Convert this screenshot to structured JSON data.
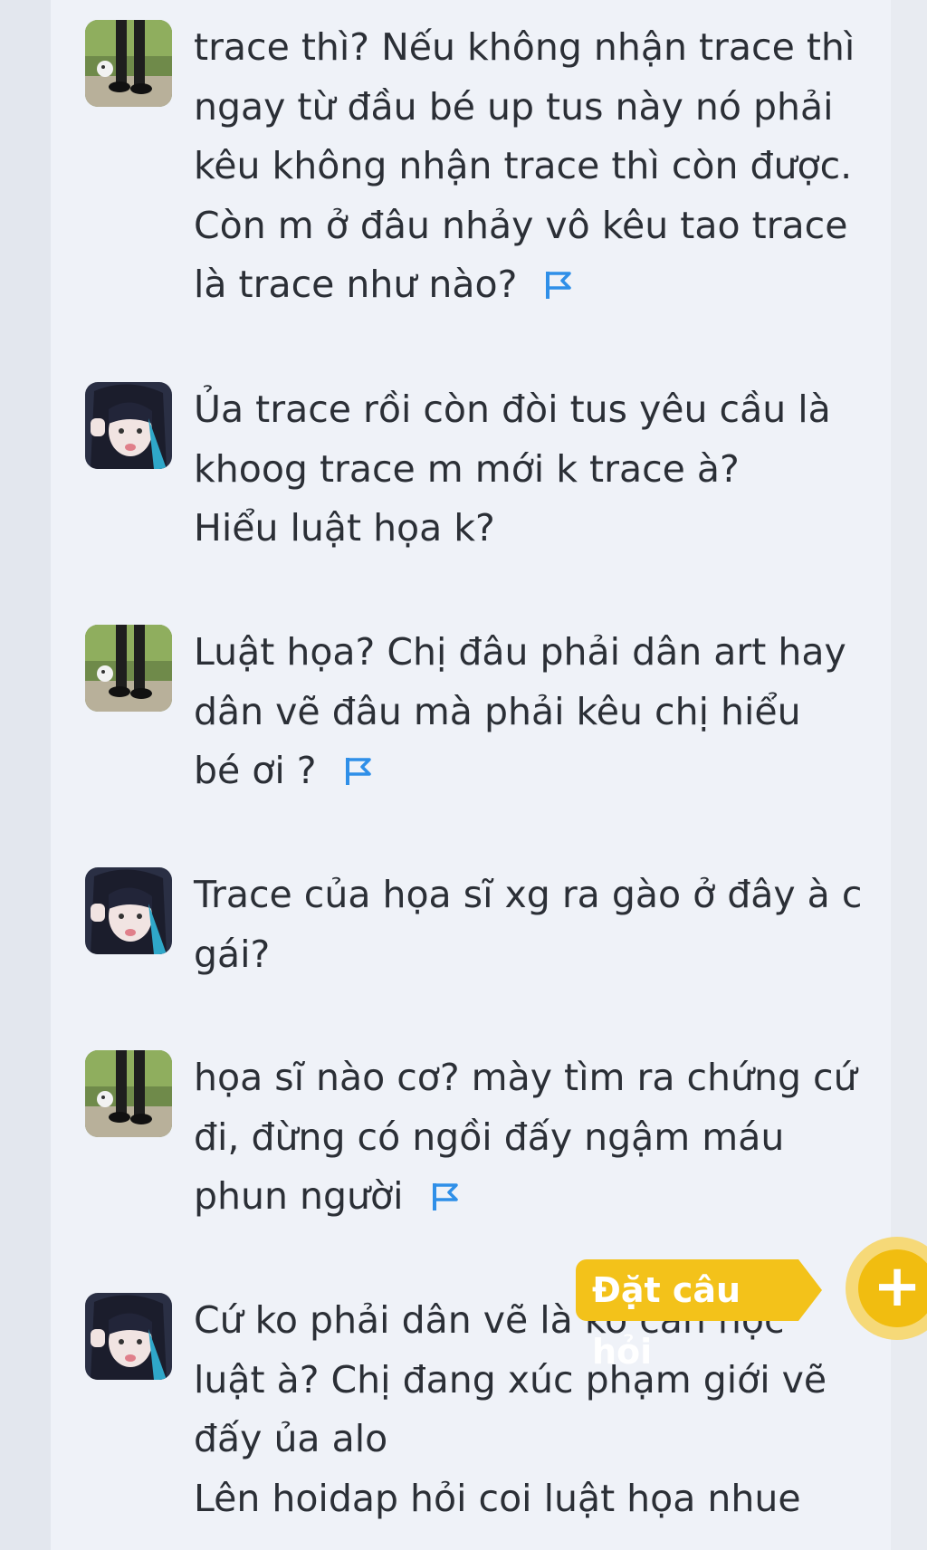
{
  "comments": [
    {
      "avatar": "avatar-girl-legs",
      "lines": [
        "trace thì? Nếu không nhận trace thì",
        "ngay từ đầu bé up tus này nó phải",
        "kêu không nhận trace thì còn được.",
        "Còn m ở đâu nhảy vô kêu tao trace",
        "là trace như nào?"
      ],
      "flagged": true
    },
    {
      "avatar": "avatar-anime-girl",
      "lines": [
        "Ủa trace rồi còn đòi tus yêu cầu là",
        "khoog trace m mới k trace à?",
        "Hiểu luật họa k?"
      ],
      "flagged": false
    },
    {
      "avatar": "avatar-girl-legs",
      "lines": [
        "Luật họa? Chị đâu phải dân art hay",
        "dân vẽ đâu mà phải kêu chị hiểu",
        "bé ơi ?"
      ],
      "flagged": true
    },
    {
      "avatar": "avatar-anime-girl",
      "lines": [
        "Trace của họa sĩ xg ra gào ở đây à c",
        "gái?"
      ],
      "flagged": false
    },
    {
      "avatar": "avatar-girl-legs",
      "lines": [
        "họa sĩ nào cơ? mày tìm ra chứng cứ",
        "đi, đừng có ngồi đấy ngậm máu",
        "phun người"
      ],
      "flagged": true
    },
    {
      "avatar": "avatar-anime-girl",
      "lines": [
        "Cứ ko phải dân vẽ là ko cần học",
        "luật à? Chị đang xúc phạm giới vẽ",
        "đấy ủa alo",
        "Lên hoidap hỏi coi luật họa nhue"
      ],
      "flagged": false
    }
  ],
  "ask_button": {
    "label": "Đặt câu hỏi",
    "icon": "plus-icon",
    "color": "#f1bd10"
  },
  "colors": {
    "flag": "#2f8fe8",
    "text": "#2b2f36",
    "background": "#eff2f8"
  }
}
